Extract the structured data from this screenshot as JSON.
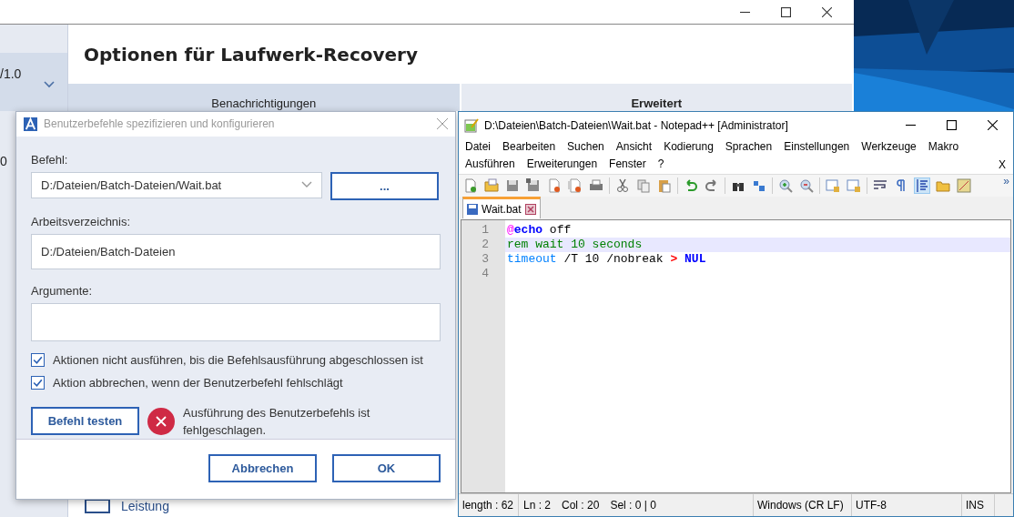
{
  "main_window": {
    "sidebar": {
      "selected_item": "/1.0",
      "item": "0"
    },
    "title": "Optionen für Laufwerk-Recovery",
    "tabs": [
      {
        "label": "Benachrichtigungen",
        "selected": false
      },
      {
        "label": "Erweitert",
        "selected": true
      }
    ],
    "bottom_item": "Leistung"
  },
  "dialog": {
    "title": "Benutzerbefehle spezifizieren und konfigurieren",
    "command": {
      "label": "Befehl:",
      "value": "D:/Dateien/Batch-Dateien/Wait.bat",
      "browse": "..."
    },
    "working_dir": {
      "label": "Arbeitsverzeichnis:",
      "value": "D:/Dateien/Batch-Dateien"
    },
    "arguments": {
      "label": "Argumente:"
    },
    "options": [
      {
        "label": "Aktionen nicht ausführen, bis die Befehlsausführung abgeschlossen ist",
        "checked": true
      },
      {
        "label": "Aktion abbrechen, wenn der Benutzerbefehl fehlschlägt",
        "checked": true
      }
    ],
    "test_button": "Befehl testen",
    "error": "Ausführung des Benutzerbefehls ist fehlgeschlagen.",
    "buttons": [
      "Abbrechen",
      "OK"
    ]
  },
  "notepad": {
    "title": "D:\\Dateien\\Batch-Dateien\\Wait.bat - Notepad++ [Administrator]",
    "menu": [
      "Datei",
      "Bearbeiten",
      "Suchen",
      "Ansicht",
      "Kodierung",
      "Sprachen",
      "Einstellungen",
      "Werkzeuge",
      "Makro",
      "Ausführen",
      "Erweiterungen",
      "Fenster",
      "?"
    ],
    "menu_close": "X",
    "toolbar": [
      {
        "kind": "new",
        "on": false
      },
      {
        "kind": "open",
        "on": false
      },
      {
        "kind": "save",
        "on": false
      },
      {
        "kind": "save-all",
        "on": false
      },
      {
        "kind": "close",
        "on": false
      },
      {
        "kind": "close-all",
        "on": false
      },
      {
        "kind": "print",
        "on": false
      },
      {
        "kind": "separator"
      },
      {
        "kind": "cut",
        "on": false
      },
      {
        "kind": "copy",
        "on": false
      },
      {
        "kind": "paste",
        "on": false
      },
      {
        "kind": "separator"
      },
      {
        "kind": "undo",
        "on": false
      },
      {
        "kind": "redo",
        "on": false
      },
      {
        "kind": "separator"
      },
      {
        "kind": "find",
        "on": false
      },
      {
        "kind": "replace",
        "on": false
      },
      {
        "kind": "separator"
      },
      {
        "kind": "zoom-in",
        "on": false
      },
      {
        "kind": "zoom-out",
        "on": false
      },
      {
        "kind": "separator"
      },
      {
        "kind": "sync-v",
        "on": false
      },
      {
        "kind": "sync-h",
        "on": false
      },
      {
        "kind": "separator"
      },
      {
        "kind": "wrap",
        "on": false
      },
      {
        "kind": "pilcrow",
        "on": false
      },
      {
        "kind": "indent",
        "on": true
      },
      {
        "kind": "folder",
        "on": false
      },
      {
        "kind": "map",
        "on": false
      }
    ],
    "toolbar_more": "»",
    "file_tab": {
      "label": "Wait.bat",
      "selected": true
    },
    "lines": [
      {
        "number": "1",
        "current": false,
        "tokens": [
          {
            "text": "@",
            "kind": "at"
          },
          {
            "text": "echo",
            "kind": "keyword"
          },
          {
            "text": " off",
            "kind": "plain"
          }
        ]
      },
      {
        "number": "2",
        "current": true,
        "tokens": [
          {
            "text": "rem wait 10 seconds",
            "kind": "comment"
          }
        ]
      },
      {
        "number": "3",
        "current": false,
        "tokens": [
          {
            "text": "timeout",
            "kind": "command"
          },
          {
            "text": " /T 10 /nobreak ",
            "kind": "plain"
          },
          {
            "text": ">",
            "kind": "operator"
          },
          {
            "text": " NUL",
            "kind": "keyword"
          }
        ]
      },
      {
        "number": "4",
        "current": false
      }
    ],
    "status_bar": {
      "length": "length : 62",
      "position": [
        "Ln : 2",
        "Col : 20",
        "Sel : 0 | 0"
      ],
      "eol": "Windows (CR LF)",
      "encoding": "UTF-8",
      "mode": "INS"
    }
  }
}
